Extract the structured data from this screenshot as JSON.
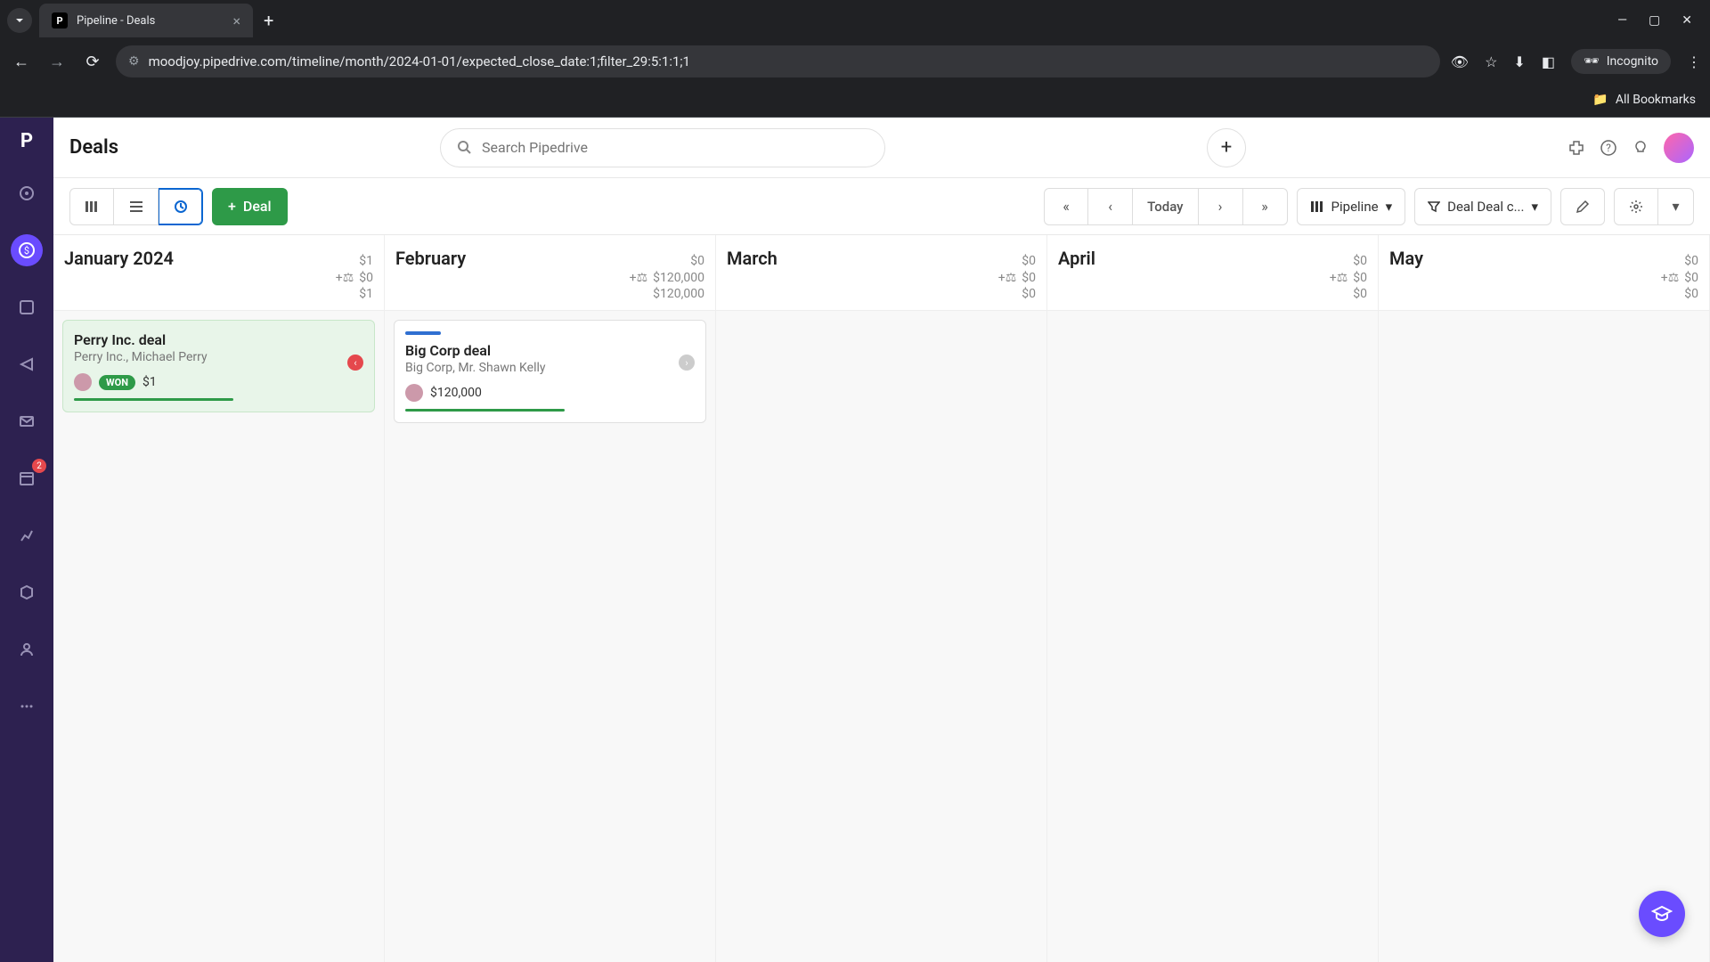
{
  "browser": {
    "tab_title": "Pipeline - Deals",
    "url": "moodjoy.pipedrive.com/timeline/month/2024-01-01/expected_close_date:1;filter_29:5:1:1;1",
    "incognito_label": "Incognito",
    "bookmarks_label": "All Bookmarks"
  },
  "sidebar": {
    "badge_count": "2"
  },
  "header": {
    "title": "Deals",
    "search_placeholder": "Search Pipedrive"
  },
  "toolbar": {
    "deal_button": "Deal",
    "today_label": "Today",
    "pipeline_label": "Pipeline",
    "filter_label": "Deal Deal c..."
  },
  "months": [
    {
      "name": "January 2024",
      "top": "$1",
      "weighted": "$0",
      "bottom": "$1"
    },
    {
      "name": "February",
      "top": "$0",
      "weighted": "$120,000",
      "bottom": "$120,000"
    },
    {
      "name": "March",
      "top": "$0",
      "weighted": "$0",
      "bottom": "$0"
    },
    {
      "name": "April",
      "top": "$0",
      "weighted": "$0",
      "bottom": "$0"
    },
    {
      "name": "May",
      "top": "$0",
      "weighted": "$0",
      "bottom": "$0"
    }
  ],
  "deals": {
    "january": {
      "title": "Perry Inc. deal",
      "subtitle": "Perry Inc., Michael Perry",
      "badge": "WON",
      "amount": "$1"
    },
    "february": {
      "title": "Big Corp deal",
      "subtitle": "Big Corp, Mr. Shawn Kelly",
      "amount": "$120,000"
    }
  }
}
